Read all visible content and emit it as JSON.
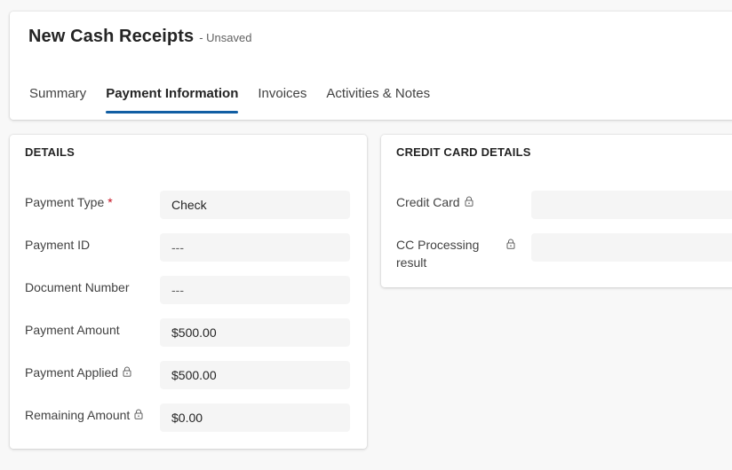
{
  "header": {
    "title": "New Cash Receipts",
    "status": "- Unsaved",
    "tabs": [
      {
        "label": "Summary",
        "active": false
      },
      {
        "label": "Payment Information",
        "active": true
      },
      {
        "label": "Invoices",
        "active": false
      },
      {
        "label": "Activities & Notes",
        "active": false
      }
    ]
  },
  "details": {
    "title": "DETAILS",
    "fields": [
      {
        "label": "Payment Type",
        "value": "Check",
        "required": "*"
      },
      {
        "label": "Payment ID",
        "value": "---"
      },
      {
        "label": "Document Number",
        "value": "---"
      },
      {
        "label": "Payment Amount",
        "value": "$500.00"
      },
      {
        "label": "Payment Applied",
        "value": "$500.00",
        "locked": true
      },
      {
        "label": "Remaining Amount",
        "value": "$0.00",
        "locked": true
      }
    ]
  },
  "credit_card": {
    "title": "CREDIT CARD DETAILS",
    "fields": [
      {
        "label": "Credit Card",
        "value": "",
        "locked": true
      },
      {
        "label": "CC Processing result",
        "value": "",
        "locked": true
      }
    ]
  },
  "colors": {
    "accent": "#115ea3",
    "required": "#c50f1f",
    "input_bg": "#f5f5f5"
  },
  "icons": {
    "lock": "lock-icon"
  }
}
